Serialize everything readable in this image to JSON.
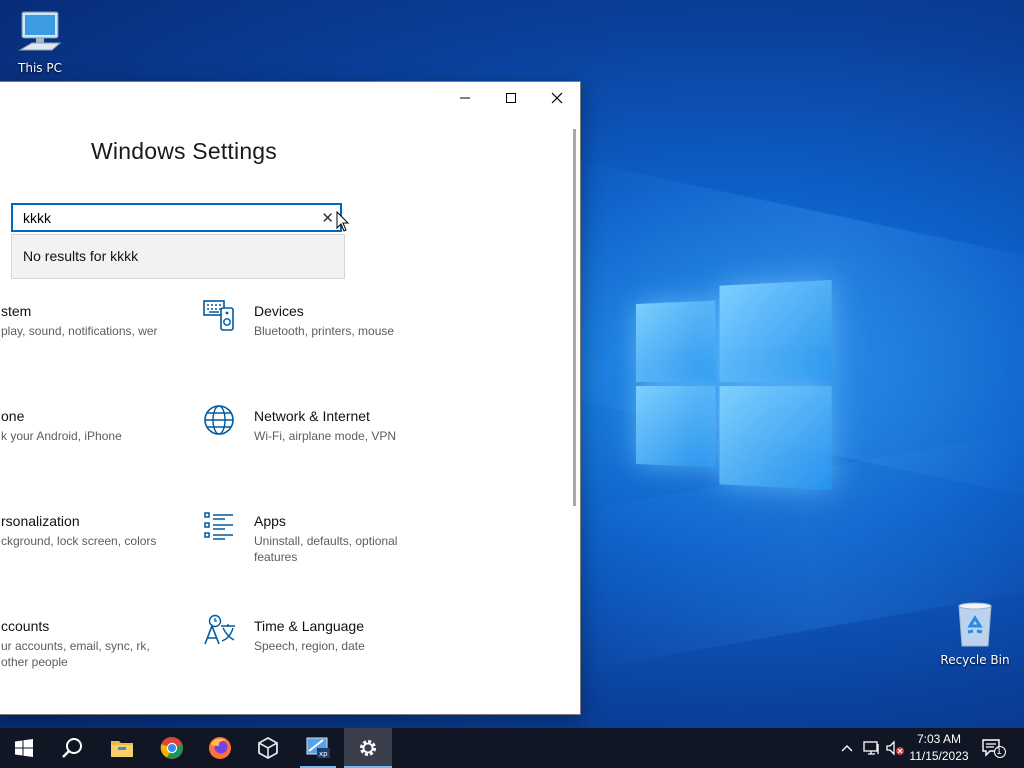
{
  "desktop": {
    "icons": [
      {
        "label": "This PC"
      },
      {
        "label": "Recycle Bin"
      }
    ]
  },
  "window": {
    "title": "Windows Settings",
    "caption": {
      "minimize": "—",
      "maximize": "☐",
      "close": "✕"
    },
    "search": {
      "value": "kkkk",
      "clear_glyph": "✕",
      "no_results": "No results for kkkk"
    },
    "categories": [
      {
        "title": "stem",
        "desc": "play, sound, notifications, wer",
        "icon": "laptop-icon"
      },
      {
        "title": "Devices",
        "desc": "Bluetooth, printers, mouse",
        "icon": "devices-icon"
      },
      {
        "title": "one",
        "desc": "k your Android, iPhone",
        "icon": "phone-icon"
      },
      {
        "title": "Network & Internet",
        "desc": "Wi-Fi, airplane mode, VPN",
        "icon": "globe-icon"
      },
      {
        "title": "rsonalization",
        "desc": "ckground, lock screen, colors",
        "icon": "brush-icon"
      },
      {
        "title": "Apps",
        "desc": "Uninstall, defaults, optional features",
        "icon": "apps-list-icon"
      },
      {
        "title": "ccounts",
        "desc": "ur accounts, email, sync, rk, other people",
        "icon": "person-icon"
      },
      {
        "title": "Time & Language",
        "desc": "Speech, region, date",
        "icon": "time-language-icon"
      }
    ]
  },
  "taskbar": {
    "apps": [
      "start-icon",
      "search-icon",
      "file-explorer-icon",
      "chrome-icon",
      "firefox-icon",
      "virtualbox-icon",
      "xp-mode-icon",
      "settings-gear-icon"
    ],
    "clock": {
      "time": "7:03 AM",
      "date": "11/15/2023"
    },
    "notification_count": "1"
  },
  "colors": {
    "accent": "#0067c0",
    "taskbar": "#101623",
    "icon_blue": "#005a9e"
  }
}
